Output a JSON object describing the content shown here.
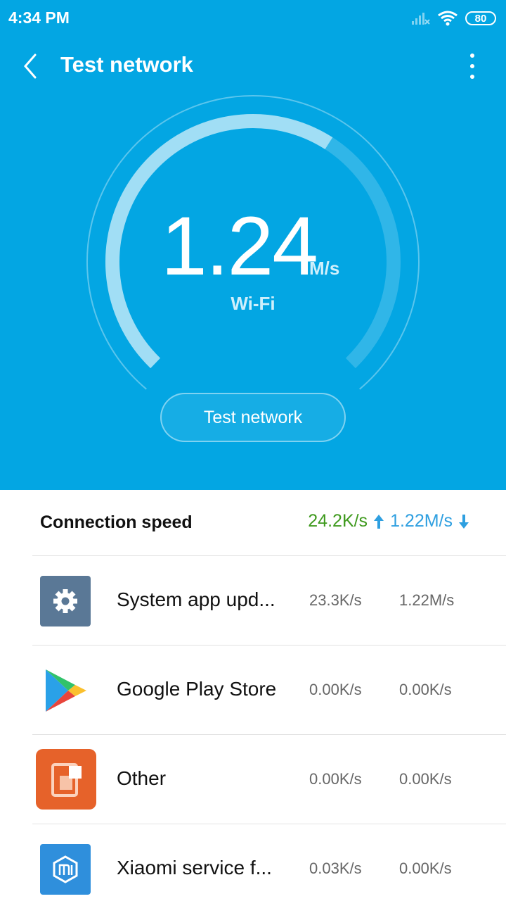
{
  "status": {
    "time": "4:34 PM",
    "battery": "80"
  },
  "toolbar": {
    "title": "Test network"
  },
  "gauge": {
    "speed": "1.24",
    "unit": "M/s",
    "network": "Wi-Fi",
    "progress": 0.62
  },
  "test_button": {
    "label": "Test network"
  },
  "connection": {
    "label": "Connection speed",
    "upload": "24.2K/s",
    "download": "1.22M/s"
  },
  "apps": [
    {
      "name": "System app upd...",
      "upload": "23.3K/s",
      "download": "1.22M/s",
      "icon": "gear-icon"
    },
    {
      "name": "Google Play Store",
      "upload": "0.00K/s",
      "download": "0.00K/s",
      "icon": "play-store-icon"
    },
    {
      "name": "Other",
      "upload": "0.00K/s",
      "download": "0.00K/s",
      "icon": "other-apps-icon"
    },
    {
      "name": "Xiaomi service f...",
      "upload": "0.03K/s",
      "download": "0.00K/s",
      "icon": "mi-icon"
    }
  ],
  "colors": {
    "hero": "#03a6e3",
    "upload": "#3f9a1e",
    "download": "#2e9fe0",
    "gear_bg": "#5a7896",
    "other_bg": "#e6622a",
    "mi_bg": "#2f8fdc"
  }
}
